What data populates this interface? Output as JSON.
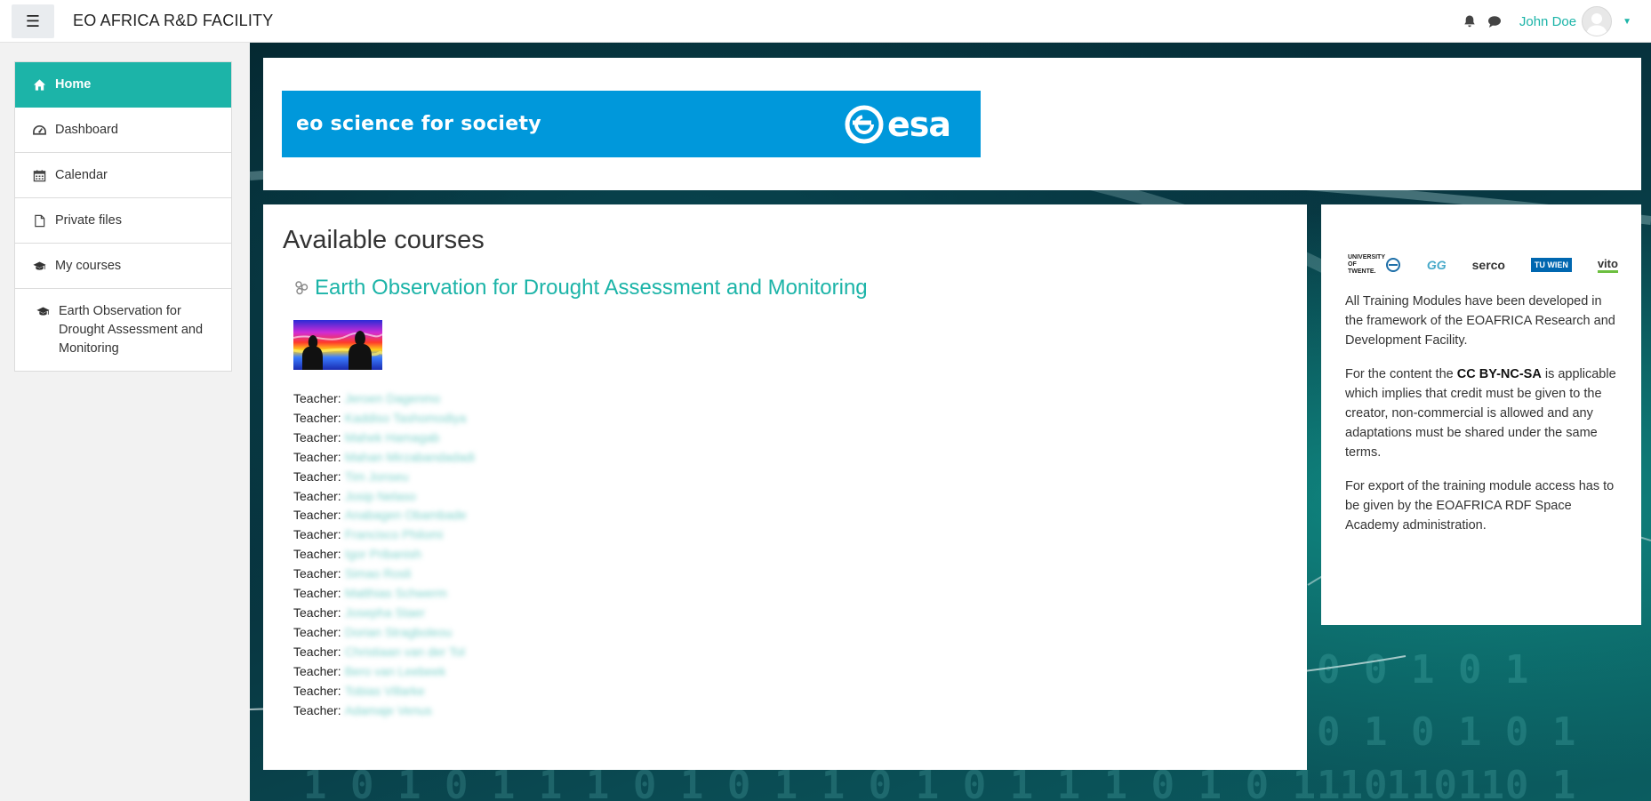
{
  "header": {
    "site_name": "EO AFRICA R&D FACILITY",
    "user_name": "John Doe"
  },
  "sidebar": {
    "items": [
      {
        "label": "Home",
        "icon": "home-icon",
        "active": true
      },
      {
        "label": "Dashboard",
        "icon": "dashboard-icon"
      },
      {
        "label": "Calendar",
        "icon": "calendar-icon"
      },
      {
        "label": "Private files",
        "icon": "file-icon"
      },
      {
        "label": "My courses",
        "icon": "graduation-cap-icon"
      },
      {
        "label": "Earth Observation for Drought Assessment and Monitoring",
        "icon": "graduation-cap-icon"
      }
    ]
  },
  "banner": {
    "tagline": "eo science for society",
    "logo_text": "esa"
  },
  "main": {
    "title": "Available courses",
    "course": {
      "title": "Earth Observation for Drought Assessment and Monitoring",
      "teacher_label": "Teacher:",
      "teachers": [
        "Jeroen Dagenmo",
        "Kaddiso Tashomodiya",
        "Mahek Hamagab",
        "Mahan Mirzabandadadi",
        "Tim Jonseu",
        "Josip Nelaso",
        "Anabagen Obambade",
        "Francisco Philomi",
        "Igor Pribanish",
        "Simao Rosli",
        "Matthias Schwerm",
        "Josepha Staer",
        "Dorian Stragboleou",
        "Christiaan van der Tol",
        "Bero van Leebeek",
        "Tobias Villarke",
        "Adamaje Venus"
      ]
    }
  },
  "side": {
    "partners": [
      "UNIVERSITY OF TWENTE.",
      "GG",
      "serco",
      "TU WIEN",
      "vito"
    ],
    "para1": "All Training Modules have been developed in the framework of the EOAFRICA Research and Development Facility.",
    "para2_prefix": "For the content the ",
    "para2_bold": "CC BY-NC-SA",
    "para2_suffix": " is applicable which implies that credit must be given to the creator, non-commercial is allowed and any adaptations must be shared under the same terms.",
    "para3": "For export of the training module access has to be given by the EOAFRICA RDF Space Academy administration."
  },
  "colors": {
    "accent": "#1cb4a8",
    "esa_blue": "#0098db"
  }
}
